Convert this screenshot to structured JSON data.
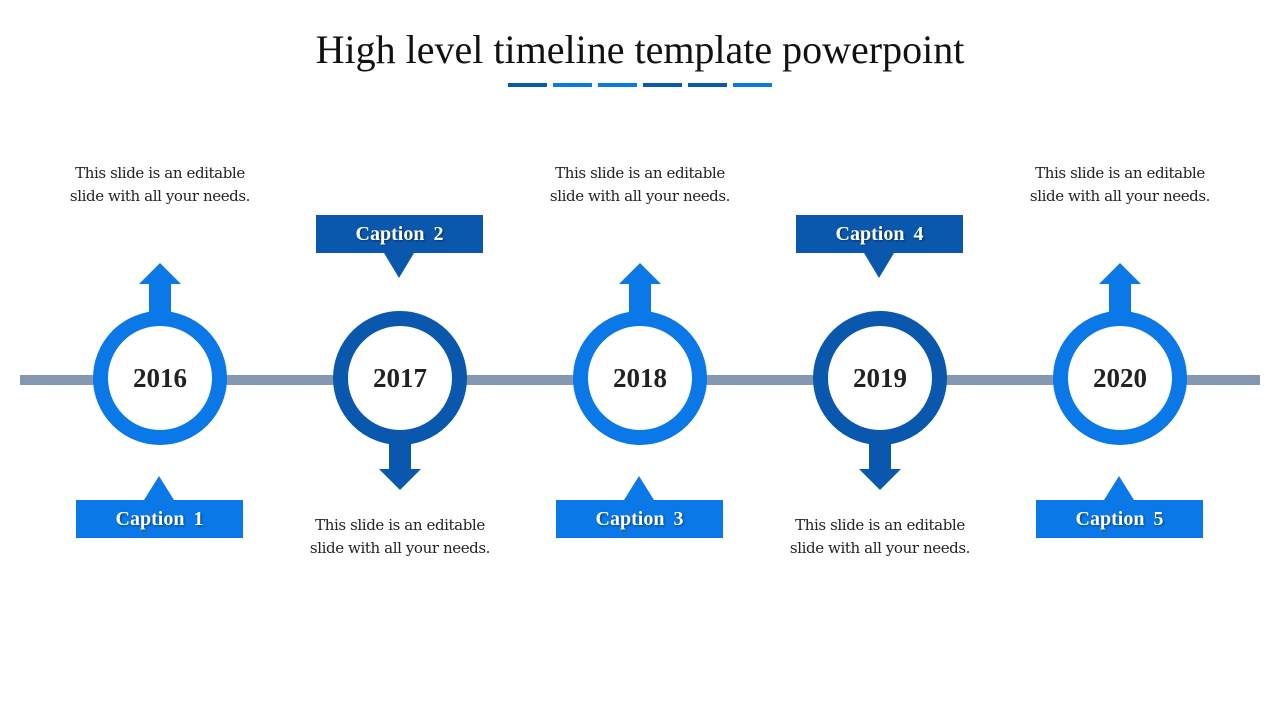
{
  "title": "High level timeline template powerpoint",
  "colors": {
    "bright_blue": "#0a78e6",
    "dark_blue": "#0a58ad",
    "line_gray": "#8497b0",
    "text_dark": "#222222"
  },
  "title_dashes": [
    "dark",
    "bright",
    "bright",
    "dark",
    "dark",
    "bright"
  ],
  "items": [
    {
      "year": "2016",
      "caption": "Caption 1",
      "description": "This slide is an editable slide with all your needs.",
      "orientation": "up",
      "tone": "bright"
    },
    {
      "year": "2017",
      "caption": "Caption  2",
      "description": "This slide is an editable slide with all your needs.",
      "orientation": "down",
      "tone": "dark"
    },
    {
      "year": "2018",
      "caption": "Caption  3",
      "description": "This slide is an editable slide with all your needs.",
      "orientation": "up",
      "tone": "bright"
    },
    {
      "year": "2019",
      "caption": "Caption  4",
      "description": "This slide is an editable slide with all your needs.",
      "orientation": "down",
      "tone": "dark"
    },
    {
      "year": "2020",
      "caption": "Caption  5",
      "description": "This slide is an editable slide with all your needs.",
      "orientation": "up",
      "tone": "bright"
    }
  ]
}
